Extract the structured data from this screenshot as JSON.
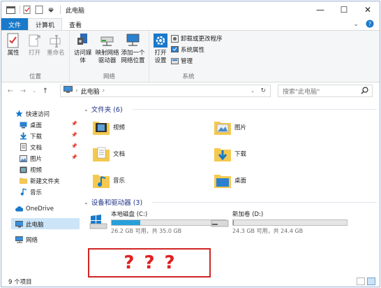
{
  "window": {
    "title": "此电脑"
  },
  "window_controls": {
    "minimize": "—",
    "maximize": "☐",
    "close": "✕"
  },
  "ribbon_tabs": [
    {
      "label": "文件",
      "active": false
    },
    {
      "label": "计算机",
      "active": true
    },
    {
      "label": "查看",
      "active": false
    }
  ],
  "ribbon": {
    "groups": [
      {
        "label": "位置",
        "buttons": [
          "属性",
          "打开",
          "重命名"
        ]
      },
      {
        "label": "网络",
        "buttons": [
          "访问媒体",
          "映射网络\n驱动器",
          "添加一个\n网络位置"
        ]
      },
      {
        "label": "系统",
        "buttons": [
          "打开\n设置"
        ],
        "small": [
          "卸载或更改程序",
          "系统属性",
          "管理"
        ]
      }
    ]
  },
  "address": {
    "crumbs": [
      "此电脑"
    ],
    "search_placeholder": "搜索\"此电脑\""
  },
  "nav": {
    "items": [
      {
        "label": "快速访问",
        "icon": "star-icon"
      },
      {
        "label": "桌面",
        "icon": "desktop-icon",
        "pinned": true
      },
      {
        "label": "下载",
        "icon": "download-icon",
        "pinned": true
      },
      {
        "label": "文档",
        "icon": "document-icon",
        "pinned": true
      },
      {
        "label": "图片",
        "icon": "picture-icon",
        "pinned": true
      },
      {
        "label": "视频",
        "icon": "video-icon"
      },
      {
        "label": "新建文件夹",
        "icon": "folder-icon"
      },
      {
        "label": "音乐",
        "icon": "music-icon"
      },
      {
        "label": "OneDrive",
        "icon": "cloud-icon"
      },
      {
        "label": "此电脑",
        "icon": "computer-icon",
        "selected": true
      },
      {
        "label": "网络",
        "icon": "network-icon"
      }
    ]
  },
  "folders_section": {
    "title": "文件夹 (6)",
    "items": [
      "视频",
      "图片",
      "文档",
      "下载",
      "音乐",
      "桌面"
    ]
  },
  "drives_section": {
    "title": "设备和驱动器 (3)",
    "items": [
      {
        "name": "本地磁盘 (C:)",
        "info": "26.2 GB 可用，共 35.0 GB",
        "used_fraction": 0.25
      },
      {
        "name": "新加卷 (D:)",
        "info": "24.3 GB 可用，共 24.4 GB",
        "used_fraction": 0.004
      }
    ]
  },
  "annotation": {
    "text": "???"
  },
  "status": {
    "item_count": "9 个项目"
  },
  "colors": {
    "accent": "#1979ca",
    "highlight": "#cce4f7",
    "drive_bar": "#26a0da",
    "annotation": "#d22525"
  }
}
